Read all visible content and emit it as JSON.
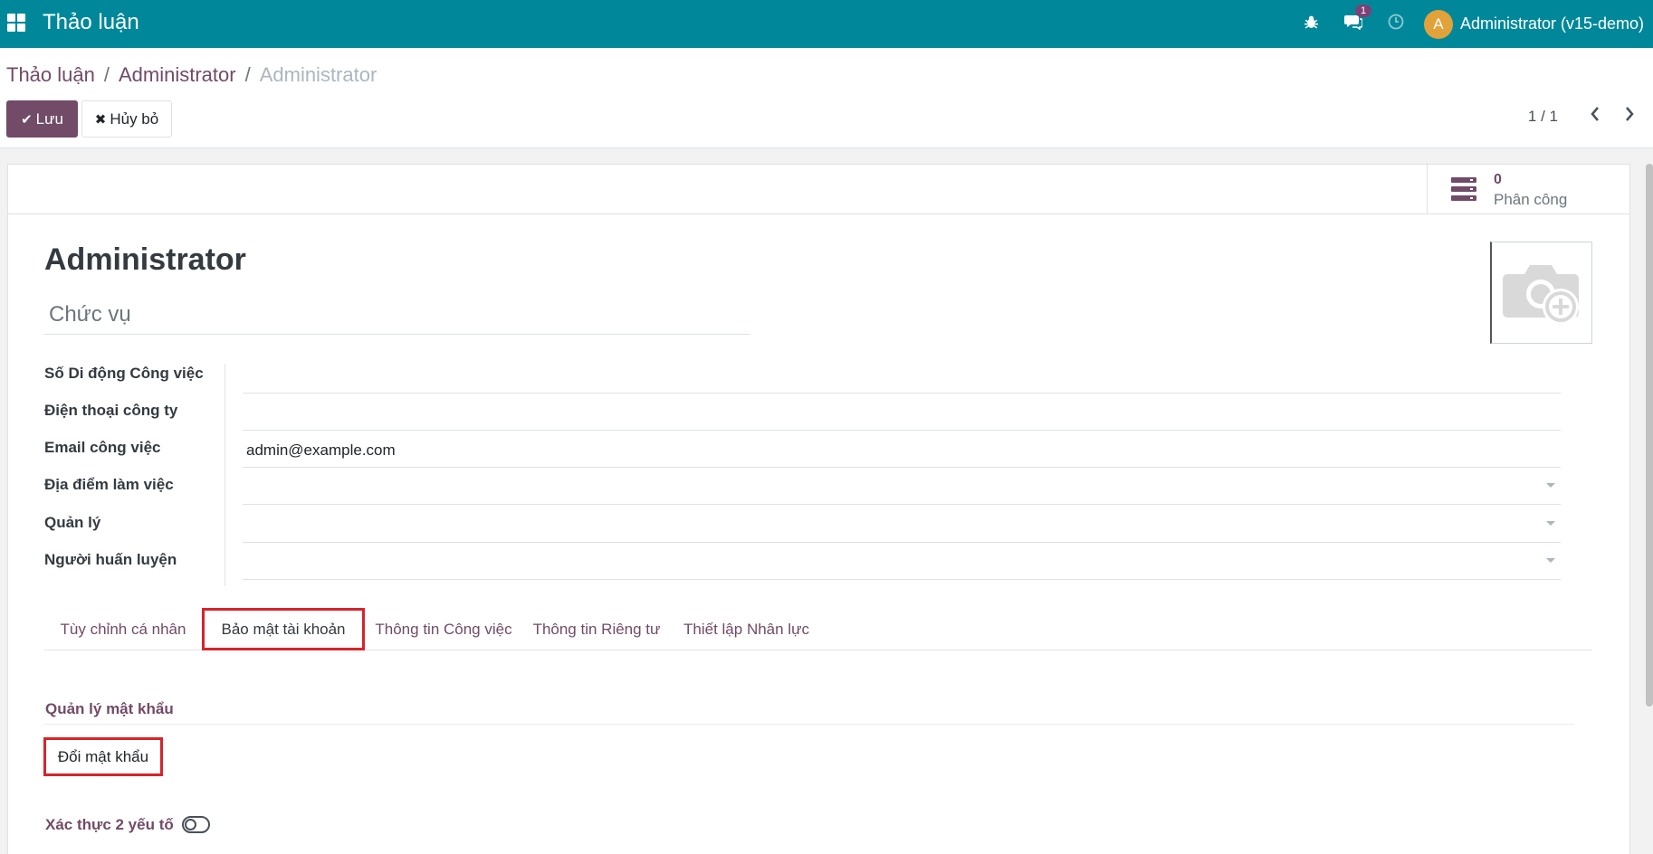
{
  "app": {
    "title": "Thảo luận"
  },
  "navbar": {
    "messages_badge": "1",
    "avatar_letter": "A",
    "user_name": "Administrator (v15-demo)"
  },
  "breadcrumb": {
    "item1": "Thảo luận",
    "item2": "Administrator",
    "current": "Administrator"
  },
  "toolbar": {
    "save_label": "Lưu",
    "discard_label": "Hủy bỏ"
  },
  "pager": {
    "text": "1 / 1"
  },
  "stat_button": {
    "value": "0",
    "label": "Phân công"
  },
  "employee": {
    "name": "Administrator",
    "job_title_placeholder": "Chức vụ"
  },
  "fields": [
    {
      "label": "Số Di động Công việc",
      "value": ""
    },
    {
      "label": "Điện thoại công ty",
      "value": ""
    },
    {
      "label": "Email công việc",
      "value": "admin@example.com"
    },
    {
      "label": "Địa điểm làm việc",
      "value": ""
    },
    {
      "label": "Quản lý",
      "value": ""
    },
    {
      "label": "Người huấn luyện",
      "value": ""
    }
  ],
  "tabs": [
    {
      "label": "Tùy chỉnh cá nhân"
    },
    {
      "label": "Bảo mật tài khoản"
    },
    {
      "label": "Thông tin Công việc"
    },
    {
      "label": "Thông tin Riêng tư"
    },
    {
      "label": "Thiết lập Nhân lực"
    }
  ],
  "security": {
    "section_title": "Quản lý mật khẩu",
    "change_password_label": "Đổi mật khẩu",
    "twofa_label": "Xác thực 2 yếu tố"
  },
  "colors": {
    "navbar": "#00889a",
    "primary": "#714B67",
    "highlight": "#d8232a",
    "avatar": "#e2a23a"
  }
}
